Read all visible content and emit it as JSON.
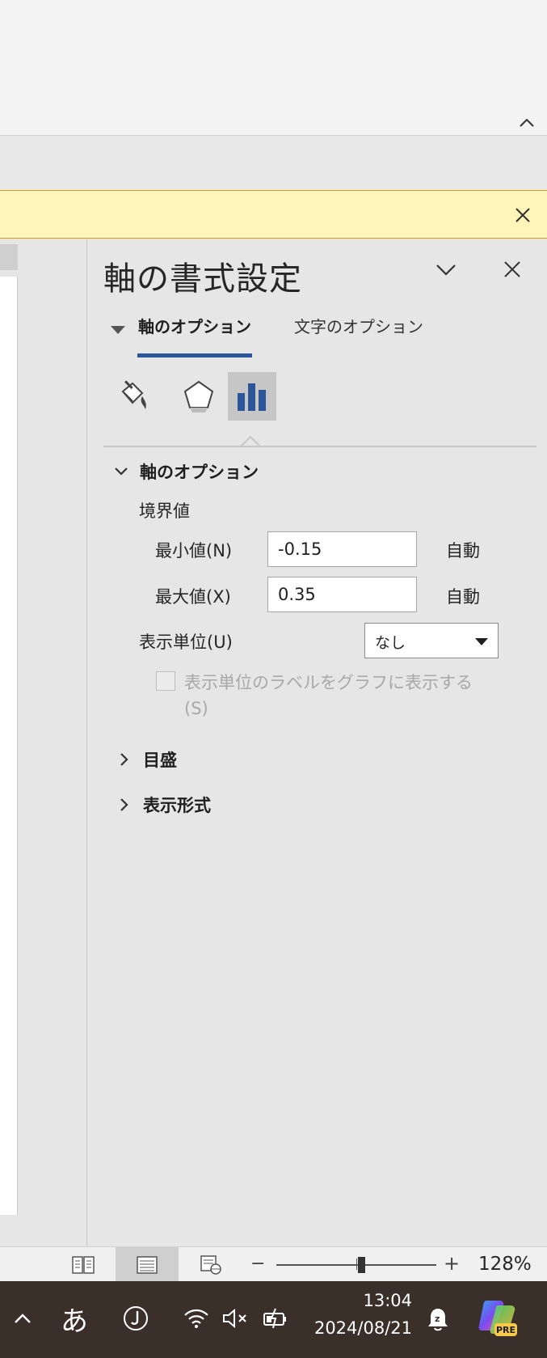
{
  "ribbon": {
    "collapse_icon": "chevron-up-icon"
  },
  "infobar": {
    "close_icon": "close-icon"
  },
  "pane": {
    "title": "軸の書式設定",
    "tabs": [
      {
        "label": "軸のオプション",
        "active": true
      },
      {
        "label": "文字のオプション",
        "active": false
      }
    ],
    "icon_tabs": [
      "fill-line-icon",
      "effects-icon",
      "axis-options-icon"
    ],
    "sections": {
      "axis_options": {
        "label": "軸のオプション",
        "expanded": true,
        "bounds_label": "境界値",
        "min_label": "最小値(N)",
        "min_value": "-0.15",
        "min_auto": "自動",
        "max_label": "最大値(X)",
        "max_value": "0.35",
        "max_auto": "自動",
        "display_units_label": "表示単位(U)",
        "display_units_value": "なし",
        "show_units_label": "表示単位のラベルをグラフに表示する (S)"
      },
      "tick_marks": {
        "label": "目盛",
        "expanded": false
      },
      "number": {
        "label": "表示形式",
        "expanded": false
      }
    }
  },
  "statusbar": {
    "zoom_minus": "−",
    "zoom_plus": "+",
    "zoom_percent": "128%",
    "zoom_fraction": 0.5
  },
  "taskbar": {
    "ime_label": "あ",
    "time": "13:04",
    "date": "2024/08/21",
    "copilot_badge": "PRE"
  },
  "colors": {
    "accent": "#2b579a",
    "infobar_bg": "#fdf6b8",
    "taskbar_bg": "#3b2f2a"
  }
}
